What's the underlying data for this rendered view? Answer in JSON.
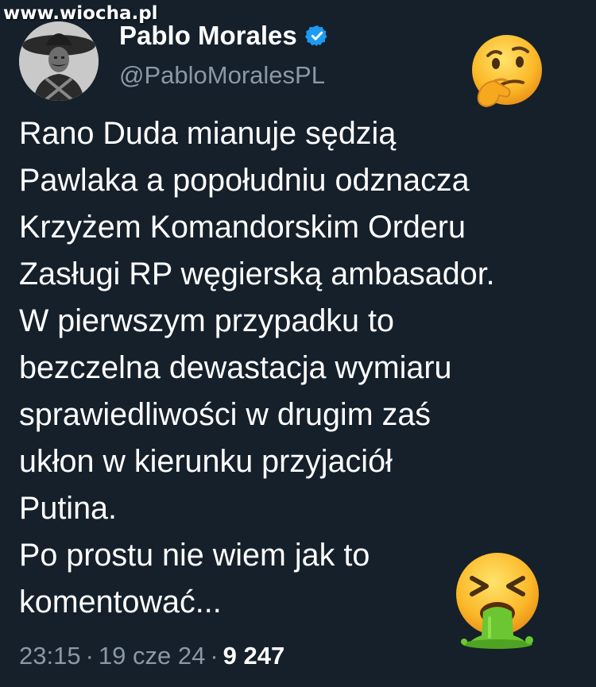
{
  "watermark": "www.wiocha.pl",
  "author": {
    "display_name": "Pablo Morales",
    "handle": "@PabloMoralesPL",
    "verified": true,
    "verified_icon": "verified-badge-icon",
    "avatar_icon": "avatar-photo"
  },
  "tweet": {
    "lines": [
      "Rano Duda mianuje sędzią",
      "Pawlaka a popołudniu odznacza",
      "Krzyżem Komandorskim Orderu",
      "Zasługi RP węgierską ambasador.",
      "W pierwszym przypadku to",
      "bezczelna dewastacja wymiaru",
      "sprawiedliwości w drugim zaś",
      "ukłon w kierunku przyjaciół",
      "Putina.",
      "Po prostu nie wiem jak to",
      "komentować..."
    ]
  },
  "meta": {
    "time": "23:15",
    "date": "19 cze 24",
    "separator": "·",
    "views": "9 247"
  },
  "emojis": {
    "top": "thinking-face-emoji",
    "bottom": "vomiting-face-emoji"
  },
  "colors": {
    "background": "#15202b",
    "secondary_text": "#8b98a5",
    "verified": "#1d9bf0"
  }
}
